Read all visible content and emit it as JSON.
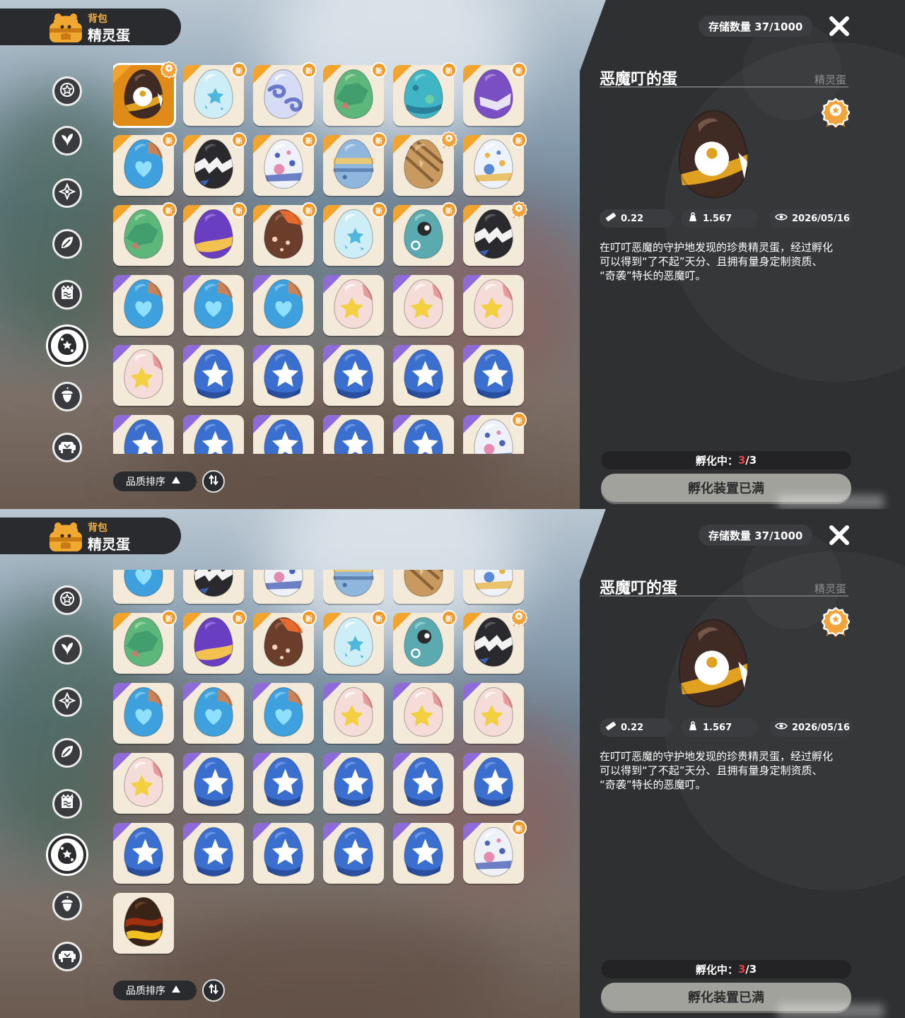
{
  "header": {
    "subtitle": "背包",
    "title": "精灵蛋"
  },
  "sidebar": {
    "categories": [
      "star-badge-icon",
      "leaf-icon",
      "sparkle-icon",
      "plant-icon",
      "scroll-icon",
      "egg-icon",
      "acorn-icon",
      "sofa-icon"
    ],
    "active_index": 5
  },
  "sort": {
    "label": "品质排序"
  },
  "storage": {
    "text": "存储数量 37/1000"
  },
  "detail": {
    "name": "恶魔叮的蛋",
    "category": "精灵蛋",
    "stats": {
      "size": "0.22",
      "weight": "1.567",
      "date": "2026/05/16"
    },
    "description": [
      "在叮叮恶魔的守护地发现的珍贵精灵蛋，经过孵化",
      "可以得到“了不起”天分、且拥有量身定制资质、",
      "“奇袭”特长的恶魔叮。"
    ]
  },
  "hatch": {
    "label": "孵化中：",
    "current": "3",
    "max": "/3",
    "button": "孵化装置已满"
  },
  "badges": {
    "new": "新"
  },
  "colors": {
    "panel": "#2f3032",
    "accent": "#f3a42c",
    "rare": "#8f6ad9",
    "slot": "#f3ead9"
  },
  "eggs": [
    {
      "kind": "demon",
      "corner": "gold",
      "badge": "medal",
      "selected": true
    },
    {
      "kind": "ice",
      "corner": "gold",
      "badge": "new"
    },
    {
      "kind": "cloud",
      "corner": "gold",
      "badge": "new"
    },
    {
      "kind": "moss",
      "corner": "gold",
      "badge": "new"
    },
    {
      "kind": "sea",
      "corner": "gold",
      "badge": "new"
    },
    {
      "kind": "violet",
      "corner": "gold",
      "badge": "new"
    },
    {
      "kind": "heart",
      "corner": "gold",
      "badge": "new"
    },
    {
      "kind": "zebra",
      "corner": "gold",
      "badge": "new"
    },
    {
      "kind": "dotblue",
      "corner": "gold",
      "badge": "new"
    },
    {
      "kind": "robot",
      "corner": "gold",
      "badge": "new"
    },
    {
      "kind": "wood",
      "corner": "gold",
      "badge": "medal"
    },
    {
      "kind": "goldpearl",
      "corner": "gold",
      "badge": "new"
    },
    {
      "kind": "moss",
      "corner": "gold",
      "badge": "new"
    },
    {
      "kind": "violetgold",
      "corner": "gold",
      "badge": "new"
    },
    {
      "kind": "rock",
      "corner": "gold",
      "badge": "new"
    },
    {
      "kind": "ice",
      "corner": "gold",
      "badge": "new"
    },
    {
      "kind": "teal",
      "corner": "gold",
      "badge": "new"
    },
    {
      "kind": "zebra",
      "corner": "gold",
      "badge": "medal"
    },
    {
      "kind": "heart",
      "corner": "purple"
    },
    {
      "kind": "heart",
      "corner": "purple"
    },
    {
      "kind": "heart",
      "corner": "purple"
    },
    {
      "kind": "starpink",
      "corner": "purple"
    },
    {
      "kind": "starpink",
      "corner": "purple"
    },
    {
      "kind": "starpink",
      "corner": "purple"
    },
    {
      "kind": "starpink",
      "corner": "purple"
    },
    {
      "kind": "bluestar",
      "corner": "purple"
    },
    {
      "kind": "bluestar",
      "corner": "purple"
    },
    {
      "kind": "bluestar",
      "corner": "purple"
    },
    {
      "kind": "bluestar",
      "corner": "purple"
    },
    {
      "kind": "bluestar",
      "corner": "purple"
    },
    {
      "kind": "bluestar",
      "corner": "purple"
    },
    {
      "kind": "bluestar",
      "corner": "purple"
    },
    {
      "kind": "bluestar",
      "corner": "purple"
    },
    {
      "kind": "bluestar",
      "corner": "purple"
    },
    {
      "kind": "bluestar",
      "corner": "purple"
    },
    {
      "kind": "dotblue",
      "corner": "purple",
      "badge": "new"
    },
    {
      "kind": "lava",
      "corner": "none"
    }
  ]
}
